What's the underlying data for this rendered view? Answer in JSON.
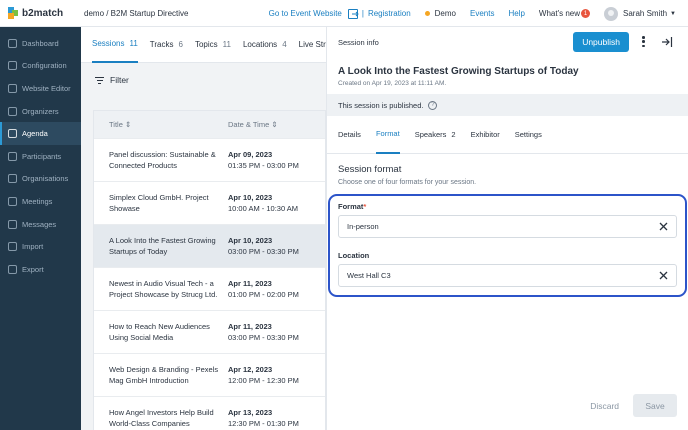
{
  "app": {
    "logo": "b2match",
    "breadcrumb": "demo / B2M Startup Directive"
  },
  "topnav": {
    "event_website": "Go to Event Website",
    "separator": "|",
    "registration": "Registration",
    "demo": "Demo",
    "events": "Events",
    "help": "Help",
    "whats_new": "What's new",
    "whats_new_badge": "1",
    "user_name": "Sarah Smith"
  },
  "sidebar": {
    "items": [
      {
        "label": "Dashboard",
        "icon": "dashboard-icon"
      },
      {
        "label": "Configuration",
        "icon": "wrench-icon"
      },
      {
        "label": "Website Editor",
        "icon": "pencil-icon"
      },
      {
        "label": "Organizers",
        "icon": "people-icon"
      },
      {
        "label": "Agenda",
        "icon": "calendar-icon"
      },
      {
        "label": "Participants",
        "icon": "people-icon"
      },
      {
        "label": "Organisations",
        "icon": "building-icon"
      },
      {
        "label": "Meetings",
        "icon": "calendar-icon"
      },
      {
        "label": "Messages",
        "icon": "envelope-icon"
      },
      {
        "label": "Import",
        "icon": "import-icon"
      },
      {
        "label": "Export",
        "icon": "export-icon"
      }
    ],
    "active_index": 4
  },
  "list": {
    "tabs": [
      {
        "label": "Sessions",
        "count": "11"
      },
      {
        "label": "Tracks",
        "count": "6"
      },
      {
        "label": "Topics",
        "count": "11"
      },
      {
        "label": "Locations",
        "count": "4"
      },
      {
        "label": "Live Streams",
        "count": ""
      }
    ],
    "filter_label": "Filter",
    "columns": {
      "title": "Title",
      "date": "Date & Time"
    },
    "rows": [
      {
        "title": "Panel discussion: Sustainable & Connected Products",
        "date": "Apr 09, 2023",
        "time": "01:35 PM - 03:00 PM"
      },
      {
        "title": "Simplex Cloud GmbH. Project Showase",
        "date": "Apr 10, 2023",
        "time": "10:00 AM - 10:30 AM"
      },
      {
        "title": "A Look Into the Fastest Growing Startups of Today",
        "date": "Apr 10, 2023",
        "time": "03:00 PM - 03:30 PM"
      },
      {
        "title": "Newest in Audio Visual Tech - a Project Showcase by Strucg Ltd.",
        "date": "Apr 11, 2023",
        "time": "01:00 PM - 02:00 PM"
      },
      {
        "title": "How to Reach New Audiences Using Social Media",
        "date": "Apr 11, 2023",
        "time": "03:00 PM - 03:30 PM"
      },
      {
        "title": "Web Design & Branding - Pexels Mag GmbH Introduction",
        "date": "Apr 12, 2023",
        "time": "12:00 PM - 12:30 PM"
      },
      {
        "title": "How Angel Investors Help Build World-Class Companies",
        "date": "Apr 13, 2023",
        "time": "12:30 PM - 01:30 PM"
      }
    ],
    "selected_index": 2
  },
  "panel": {
    "header": "Session info",
    "unpublish": "Unpublish",
    "title": "A Look Into the Fastest Growing Startups of Today",
    "created": "Created on Apr 19, 2023 at 11:11 AM.",
    "published_note": "This session is published.",
    "tabs": [
      {
        "label": "Details",
        "count": ""
      },
      {
        "label": "Format",
        "count": ""
      },
      {
        "label": "Speakers",
        "count": "2"
      },
      {
        "label": "Exhibitor",
        "count": ""
      },
      {
        "label": "Settings",
        "count": ""
      }
    ],
    "active_tab": 1,
    "section_title": "Session format",
    "section_subtitle": "Choose one of four formats for your session.",
    "format_label": "Format",
    "format_required": "*",
    "format_value": "In-person",
    "location_label": "Location",
    "location_value": "West Hall C3",
    "discard": "Discard",
    "save": "Save"
  },
  "colors": {
    "accent": "#1a8fd0",
    "sidebar": "#21384a",
    "highlight": "#2c54c9",
    "badge": "#e8553e"
  }
}
